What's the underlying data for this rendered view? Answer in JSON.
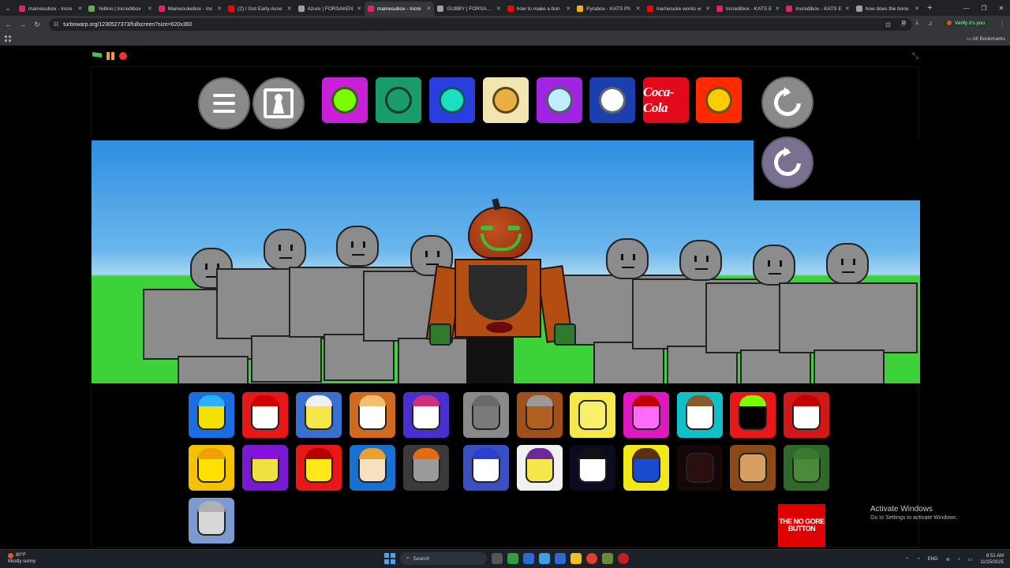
{
  "browser": {
    "tabs": [
      {
        "title": "mamesubox - Incre",
        "color": "#e0245e",
        "active": false
      },
      {
        "title": "Yellino | Incredibox",
        "color": "#6aa84f",
        "active": false
      },
      {
        "title": "Mamesukebox - Inc",
        "color": "#e0245e",
        "active": false
      },
      {
        "title": "(2) I Got Early Acce",
        "color": "#ff0000",
        "active": false
      },
      {
        "title": "Azure | FORSAKEN",
        "color": "#9aa0a6",
        "active": false
      },
      {
        "title": "mamesubox - Incre",
        "color": "#e0245e",
        "active": true
      },
      {
        "title": "GUBBY | FORSAKEN",
        "color": "#9aa0a6",
        "active": false
      },
      {
        "title": "how to make a bon",
        "color": "#ff0000",
        "active": false
      },
      {
        "title": "Pyrabox - KATS Ph",
        "color": "#f4b400",
        "active": false
      },
      {
        "title": "mamesuke works w",
        "color": "#ff0000",
        "active": false
      },
      {
        "title": "Incredibox - KATS E",
        "color": "#e0245e",
        "active": false
      },
      {
        "title": "Incredibox - KATS E",
        "color": "#e0245e",
        "active": false
      },
      {
        "title": "how does the bonu",
        "color": "#9aa0a6",
        "active": false
      }
    ],
    "url": "turbowarp.org/1230527373/fullscreen?size=620x360",
    "verify_label": "Verify it's you",
    "all_bookmarks": "All Bookmarks"
  },
  "top_packs": [
    {
      "name": "green-alien-pack",
      "bg": "#c81fd8",
      "face": "#7cfc00"
    },
    {
      "name": "teal-cat-pack",
      "bg": "#1a9b6a",
      "face": "#1a9b6a"
    },
    {
      "name": "cyan-blue-pack",
      "bg": "#2a3ee0",
      "face": "#18e0c0"
    },
    {
      "name": "clock-face-pack",
      "bg": "#f2e6b0",
      "face": "#e8b040"
    },
    {
      "name": "purple-creature-pack",
      "bg": "#a024e0",
      "face": "#bfefff"
    },
    {
      "name": "pepsi-pack",
      "bg": "#1c3fb0",
      "face": "#ffffff"
    },
    {
      "name": "coca-cola-pack",
      "bg": "#e20a1a",
      "label": "Coca-Cola"
    },
    {
      "name": "red-hood-pack",
      "bg": "#ff2a00",
      "face": "#ffcc00"
    }
  ],
  "bottom_row1": [
    {
      "name": "headphones-yellow",
      "bg": "#1a6fe0",
      "face": "#f2e000",
      "cap": "#2ab0ff"
    },
    {
      "name": "red-cap-r",
      "bg": "#e81818",
      "face": "#ffffff",
      "cap": "#d00000"
    },
    {
      "name": "white-hat-yellow",
      "bg": "#3a6fd0",
      "face": "#f5e64a",
      "cap": "#f0f0f0"
    },
    {
      "name": "straw-hat-white",
      "bg": "#d06a20",
      "face": "#ffffff",
      "cap": "#f0c070"
    },
    {
      "name": "flower-crown-white",
      "bg": "#4a2fd0",
      "face": "#ffffff",
      "cap": "#d0307a"
    },
    {
      "name": "grey-cat",
      "bg": "#8a8a8a",
      "face": "#7a7a7a",
      "cap": "#6a6a6a"
    },
    {
      "name": "bucket-brown",
      "bg": "#a05018",
      "face": "#b06020",
      "cap": "#999999"
    },
    {
      "name": "plain-yellow",
      "bg": "#f4e84a",
      "face": "#f8ef6a",
      "cap": ""
    },
    {
      "name": "pink-robot",
      "bg": "#e018c0",
      "face": "#ff6aff",
      "cap": "#c00000"
    },
    {
      "name": "brown-hair-cyan",
      "bg": "#10c0c8",
      "face": "#ffffff",
      "cap": "#8a5a2a"
    },
    {
      "name": "black-green-horns",
      "bg": "#e81818",
      "face": "#000000",
      "cap": "#7cfc00"
    },
    {
      "name": "red-666",
      "bg": "#d01818",
      "face": "#ffffff",
      "cap": "#c00000"
    }
  ],
  "bottom_row2": [
    {
      "name": "sun-face",
      "bg": "#f4c000",
      "face": "#ffe000",
      "cap": "#f0a000"
    },
    {
      "name": "purple-horns-yellow",
      "bg": "#7a1ad0",
      "face": "#f0e040",
      "cap": "#8a10e0"
    },
    {
      "name": "red-headband-yellow",
      "bg": "#e81818",
      "face": "#ffe818",
      "cap": "#b00000"
    },
    {
      "name": "burger-hat",
      "bg": "#1870d0",
      "face": "#f5e0c0",
      "cap": "#e8a030"
    },
    {
      "name": "orange-cap-grey",
      "bg": "#3a3a3a",
      "face": "#9a9a9a",
      "cap": "#e86a10"
    },
    {
      "name": "blue-spiky-white",
      "bg": "#3a50c0",
      "face": "#ffffff",
      "cap": "#2a40d0"
    },
    {
      "name": "purple-hair-white",
      "bg": "#f0f0f0",
      "face": "#f5e64a",
      "cap": "#6a2a9a"
    },
    {
      "name": "dark-hair-black",
      "bg": "#0a0a20",
      "face": "#ffffff",
      "cap": "#111111"
    },
    {
      "name": "blue-bug-yellow",
      "bg": "#f0e818",
      "face": "#1a4ad0",
      "cap": "#5a3010"
    },
    {
      "name": "dark-hidden",
      "bg": "#150707",
      "face": "#2a0f0f",
      "cap": ""
    },
    {
      "name": "brown-tan",
      "bg": "#8a4a18",
      "face": "#d8a060",
      "cap": ""
    },
    {
      "name": "green-helmet",
      "bg": "#2f6a2a",
      "face": "#4a8a3a",
      "cap": "#3a7a30"
    }
  ],
  "bottom_row3": [
    {
      "name": "grey-visor",
      "bg": "#7a9ad0",
      "face": "#d8d8d8",
      "cap": "#b0b0b0"
    }
  ],
  "no_gore_button": "THE NO GORE BUTTON",
  "watermark": {
    "line1": "Activate Windows",
    "line2": "Go to Settings to activate Windows."
  },
  "taskbar": {
    "temp": "80°F",
    "weather": "Mostly sunny",
    "search": "Search",
    "lang": "ENG",
    "time": "8:51 AM",
    "date": "11/15/2025"
  }
}
